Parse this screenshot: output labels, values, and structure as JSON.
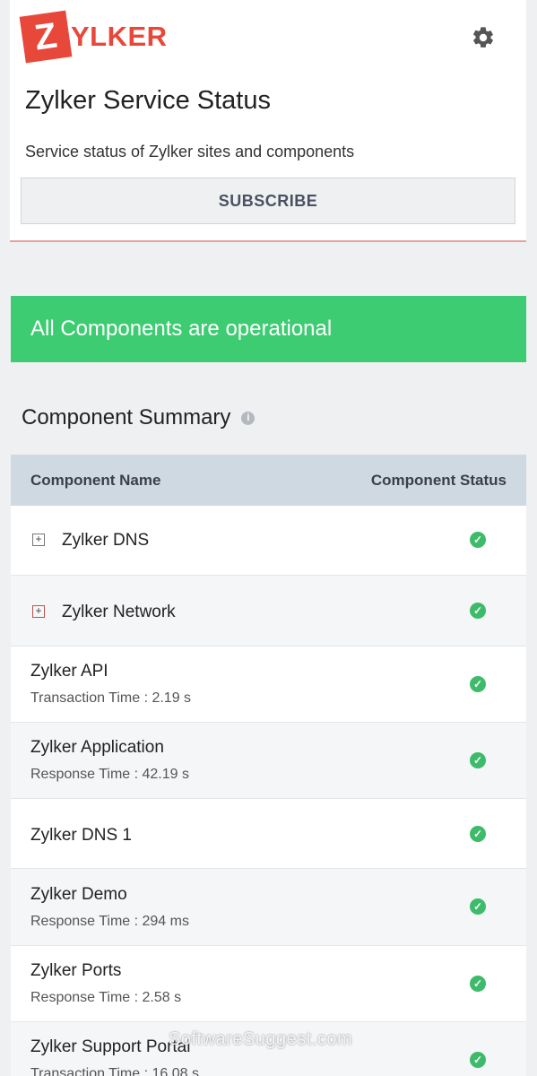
{
  "header": {
    "logo_initial": "Z",
    "logo_rest": "YLKER",
    "title": "Zylker Service Status",
    "subtitle": "Service status of Zylker sites and components",
    "subscribe_label": "SUBSCRIBE",
    "settings_icon": "gear-icon"
  },
  "banner": {
    "text": "All Components are operational",
    "color": "#3dcc72"
  },
  "summary": {
    "title": "Component Summary",
    "info_icon": "info-icon",
    "col_name": "Component Name",
    "col_status": "Component Status",
    "rows": [
      {
        "name": "Zylker DNS",
        "expandable": true,
        "sub": "",
        "status": "operational"
      },
      {
        "name": "Zylker Network",
        "expandable": true,
        "sub": "",
        "status": "operational"
      },
      {
        "name": "Zylker API",
        "expandable": false,
        "sub": "Transaction Time : 2.19 s",
        "status": "operational"
      },
      {
        "name": "Zylker Application",
        "expandable": false,
        "sub": "Response Time : 42.19 s",
        "status": "operational"
      },
      {
        "name": "Zylker DNS 1",
        "expandable": false,
        "sub": "",
        "status": "operational"
      },
      {
        "name": "Zylker Demo",
        "expandable": false,
        "sub": "Response Time : 294 ms",
        "status": "operational"
      },
      {
        "name": "Zylker Ports",
        "expandable": false,
        "sub": "Response Time : 2.58 s",
        "status": "operational"
      },
      {
        "name": "Zylker Support Portal",
        "expandable": false,
        "sub": "Transaction Time : 16.08 s",
        "status": "operational"
      }
    ]
  },
  "watermark": "SoftwareSuggest.com",
  "colors": {
    "brand": "#e8483a",
    "ok": "#3dbb6a"
  }
}
